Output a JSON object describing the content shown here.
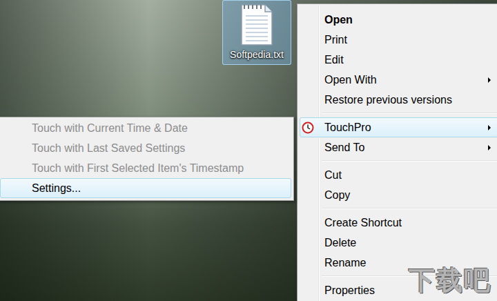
{
  "desktop": {
    "file": {
      "label": "Softpedia.txt",
      "selected": true
    },
    "watermark": "下载吧"
  },
  "context_menu": {
    "items": [
      {
        "label": "Open",
        "bold": true,
        "has_submenu": false,
        "selected": false,
        "separator_before": false,
        "icon": false
      },
      {
        "label": "Print",
        "bold": false,
        "has_submenu": false,
        "selected": false,
        "separator_before": false,
        "icon": false
      },
      {
        "label": "Edit",
        "bold": false,
        "has_submenu": false,
        "selected": false,
        "separator_before": false,
        "icon": false
      },
      {
        "label": "Open With",
        "bold": false,
        "has_submenu": true,
        "selected": false,
        "separator_before": false,
        "icon": false
      },
      {
        "label": "Restore previous versions",
        "bold": false,
        "has_submenu": false,
        "selected": false,
        "separator_before": false,
        "icon": false
      },
      {
        "label": "TouchPro",
        "bold": false,
        "has_submenu": true,
        "selected": true,
        "separator_before": true,
        "icon": true
      },
      {
        "label": "Send To",
        "bold": false,
        "has_submenu": true,
        "selected": false,
        "separator_before": false,
        "icon": false
      },
      {
        "label": "Cut",
        "bold": false,
        "has_submenu": false,
        "selected": false,
        "separator_before": true,
        "icon": false
      },
      {
        "label": "Copy",
        "bold": false,
        "has_submenu": false,
        "selected": false,
        "separator_before": false,
        "icon": false
      },
      {
        "label": "Create Shortcut",
        "bold": false,
        "has_submenu": false,
        "selected": false,
        "separator_before": true,
        "icon": false
      },
      {
        "label": "Delete",
        "bold": false,
        "has_submenu": false,
        "selected": false,
        "separator_before": false,
        "icon": false
      },
      {
        "label": "Rename",
        "bold": false,
        "has_submenu": false,
        "selected": false,
        "separator_before": false,
        "icon": false
      },
      {
        "label": "Properties",
        "bold": false,
        "has_submenu": false,
        "selected": false,
        "separator_before": true,
        "icon": false
      }
    ]
  },
  "submenu": {
    "items": [
      {
        "label": "Touch with Current Time & Date",
        "disabled": true,
        "selected": false
      },
      {
        "label": "Touch with Last Saved Settings",
        "disabled": true,
        "selected": false
      },
      {
        "label": "Touch with First Selected Item's Timestamp",
        "disabled": true,
        "selected": false
      },
      {
        "label": "Settings...",
        "disabled": false,
        "selected": true
      }
    ]
  }
}
